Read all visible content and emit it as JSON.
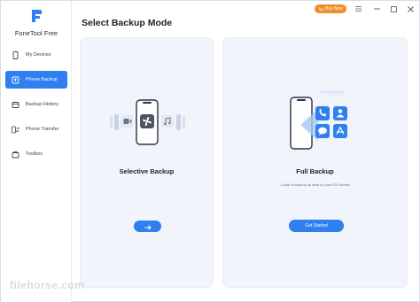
{
  "app": {
    "name": "FoneTool Free"
  },
  "header": {
    "title": "Select Backup Mode",
    "buy_label": "Buy Now"
  },
  "sidebar": {
    "items": [
      {
        "label": "My Devices",
        "icon": "phone-icon",
        "active": false
      },
      {
        "label": "Phone Backup",
        "icon": "backup-icon",
        "active": true
      },
      {
        "label": "Backup History",
        "icon": "history-icon",
        "active": false
      },
      {
        "label": "Phone Transfer",
        "icon": "transfer-icon",
        "active": false
      },
      {
        "label": "Toolbox",
        "icon": "toolbox-icon",
        "active": false
      }
    ]
  },
  "cards": {
    "selective": {
      "title": "Selective Backup",
      "button_icon": "arrow-right-icon"
    },
    "full": {
      "title": "Full Backup",
      "description": "1-click to backup all data on your iOS device",
      "button_label": "Get Started"
    }
  },
  "watermark": "filehorse.com",
  "colors": {
    "accent": "#2f7ff0",
    "buy": "#f28c28",
    "card_bg": "#f1f5fb"
  }
}
